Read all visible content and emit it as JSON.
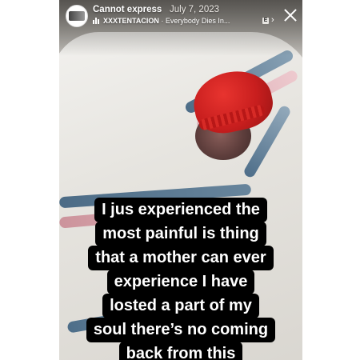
{
  "story": {
    "username": "Cannot express",
    "date": "July 7, 2023",
    "song": {
      "artist": "XXXTENTACION",
      "separator": " · ",
      "title": "Everybody Dies In...",
      "explicit_badge": "E",
      "chevron": "›"
    },
    "caption_lines": [
      "I jus  experienced the",
      "most painful is thing",
      "that a mother can ever",
      "experience I have",
      "losted a part of my",
      "soul there’s no coming",
      "back from this"
    ]
  },
  "colors": {
    "hat_red": "#c81e1e",
    "stripe_blue": "#3b5e7c",
    "stripe_pink": "#e3b4bb",
    "caption_bg": "#000000",
    "caption_text": "#ffffff"
  }
}
